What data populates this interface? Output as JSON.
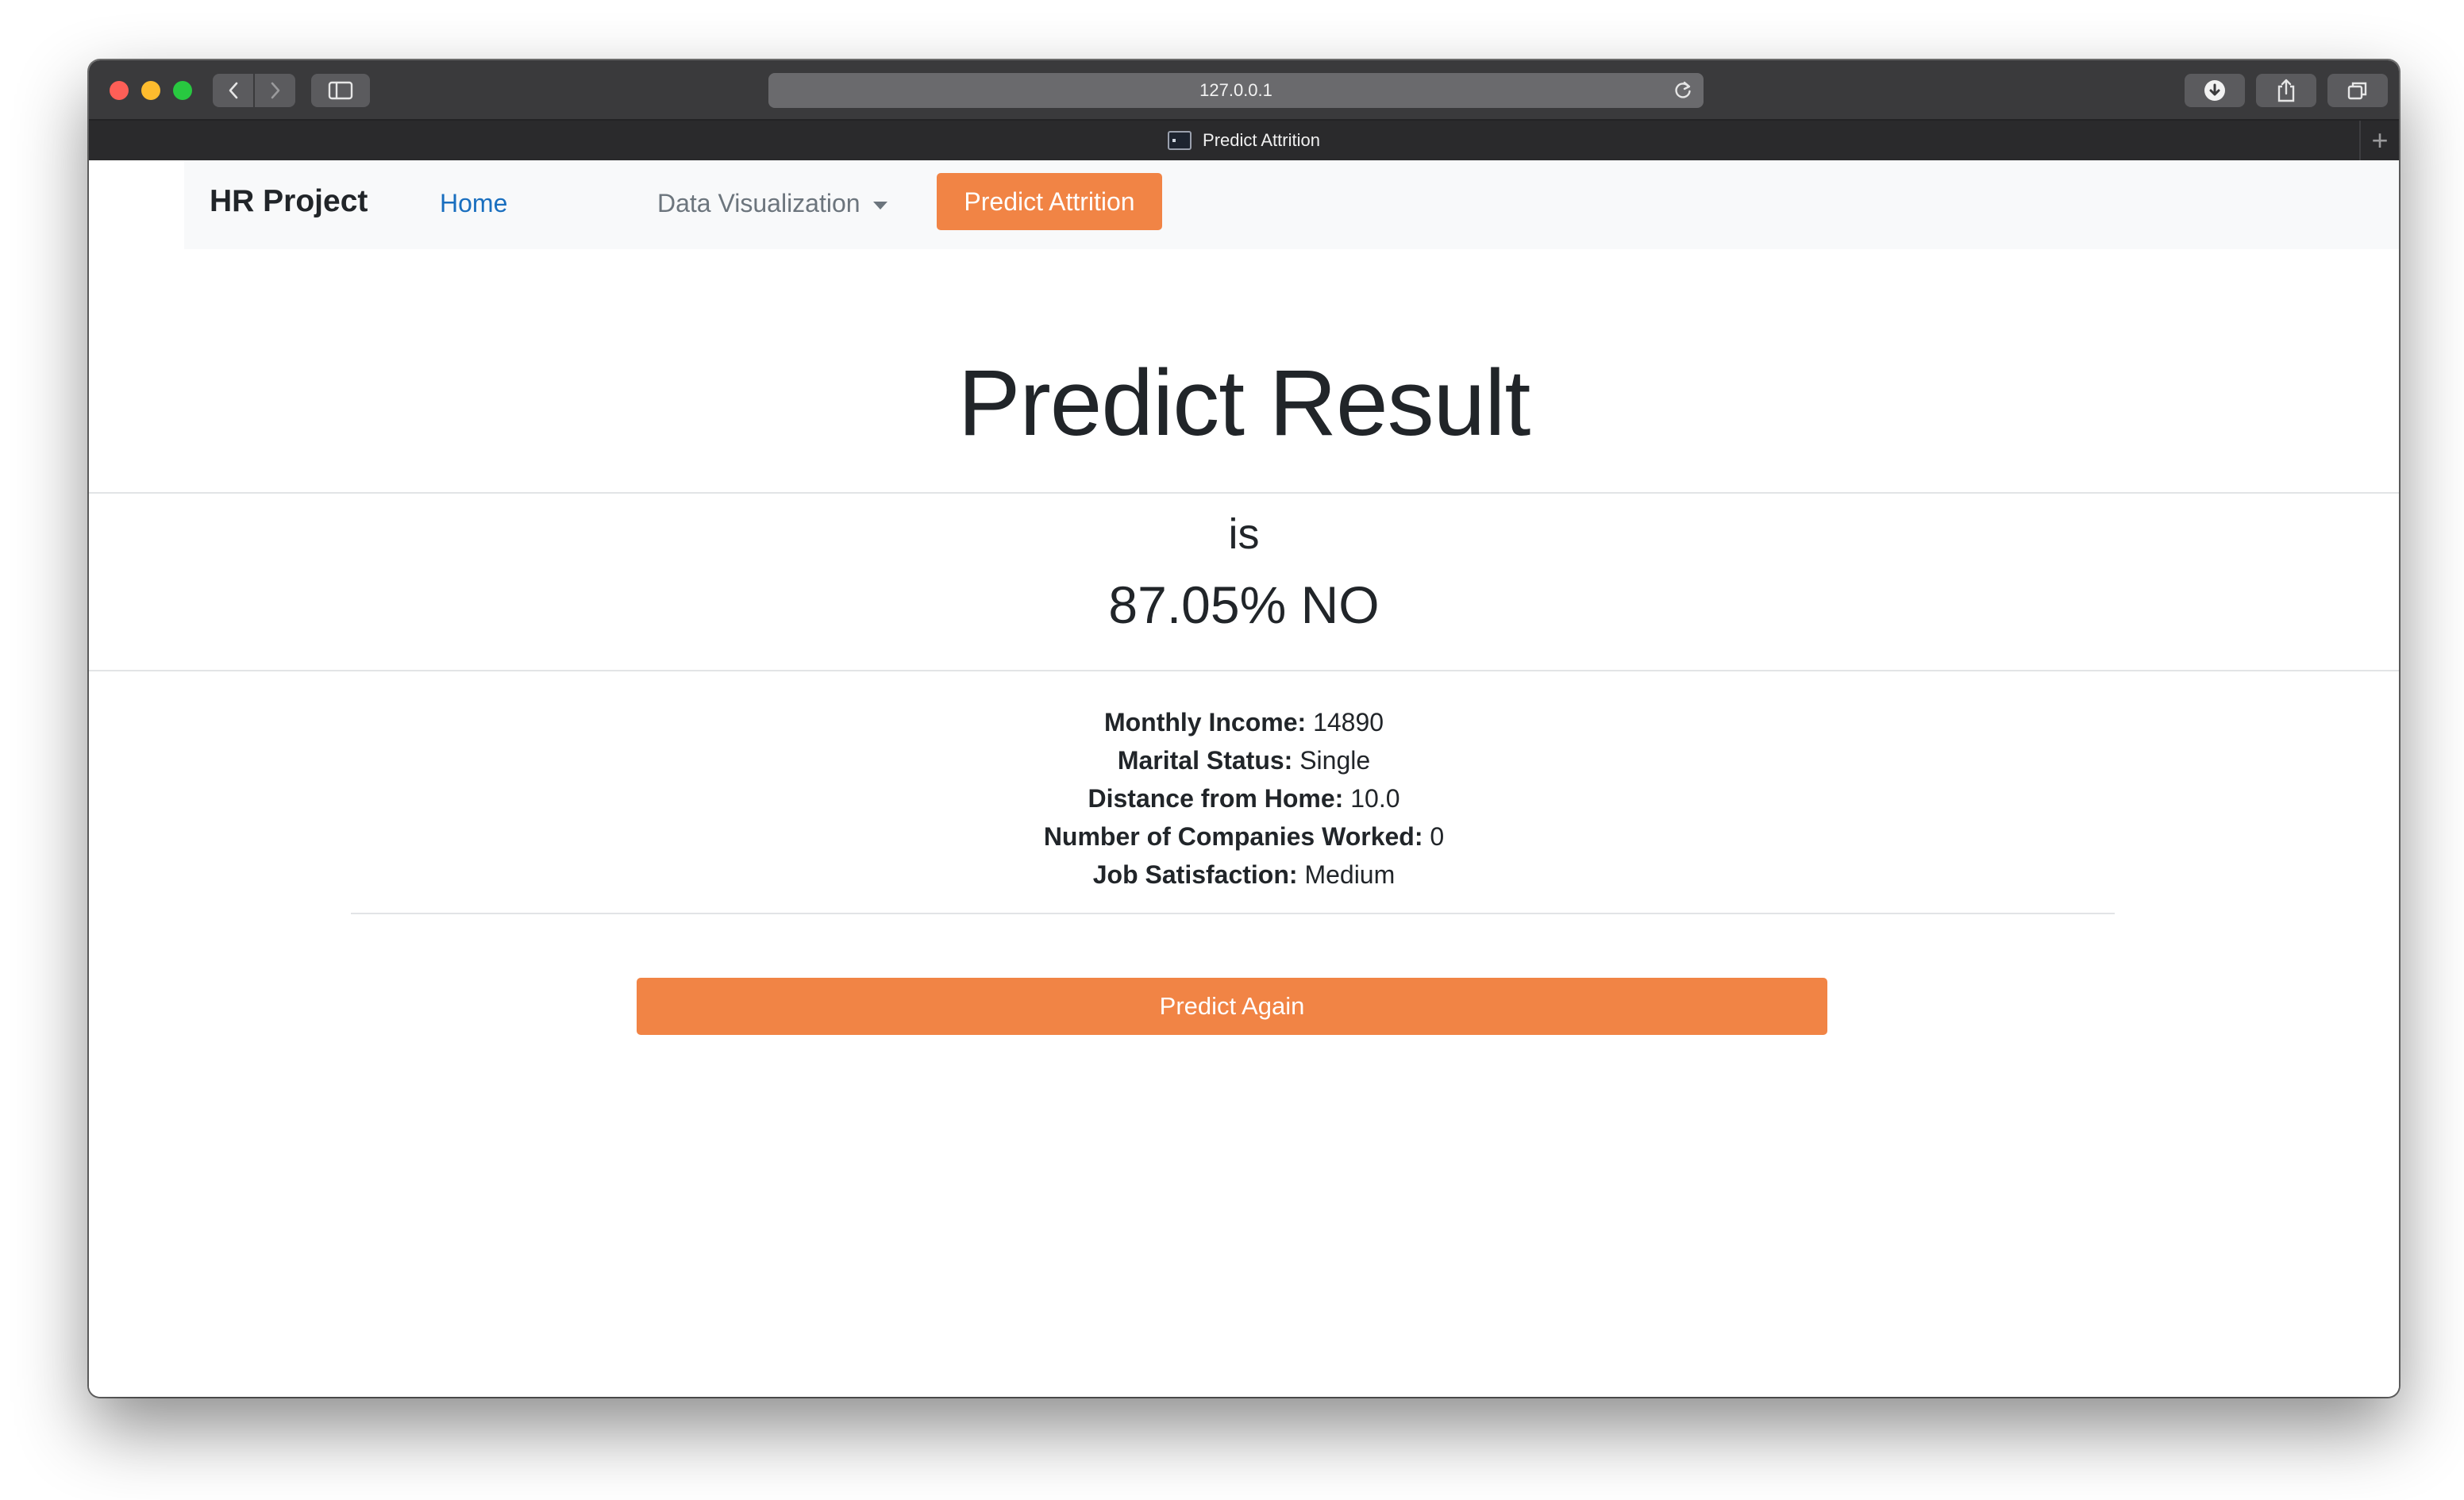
{
  "browser": {
    "url": "127.0.0.1",
    "tab_title": "Predict Attrition",
    "new_tab_symbol": "+"
  },
  "navbar": {
    "brand": "HR Project",
    "items": [
      {
        "label": "Home"
      },
      {
        "label": "Data Visualization"
      },
      {
        "label": "Predict Attrition"
      }
    ]
  },
  "main": {
    "title": "Predict Result",
    "is_label": "is",
    "result": "87.05% NO",
    "details": [
      {
        "label": "Monthly Income:",
        "value": "14890"
      },
      {
        "label": "Marital Status:",
        "value": "Single"
      },
      {
        "label": "Distance from Home:",
        "value": "10.0"
      },
      {
        "label": "Number of Companies Worked:",
        "value": "0"
      },
      {
        "label": "Job Satisfaction:",
        "value": "Medium"
      }
    ],
    "predict_again_label": "Predict Again"
  },
  "colors": {
    "accent": "#f18445",
    "link": "#1a6fbf",
    "navbar_bg": "#f8f9fa",
    "text": "#212529"
  },
  "icons": {
    "back": "chevron-left-icon",
    "forward": "chevron-right-icon",
    "sidebar": "sidebar-icon",
    "reload": "reload-icon",
    "download": "download-icon",
    "share": "share-icon",
    "tabs": "tabs-overview-icon",
    "favicon": "terminal-favicon-icon"
  }
}
